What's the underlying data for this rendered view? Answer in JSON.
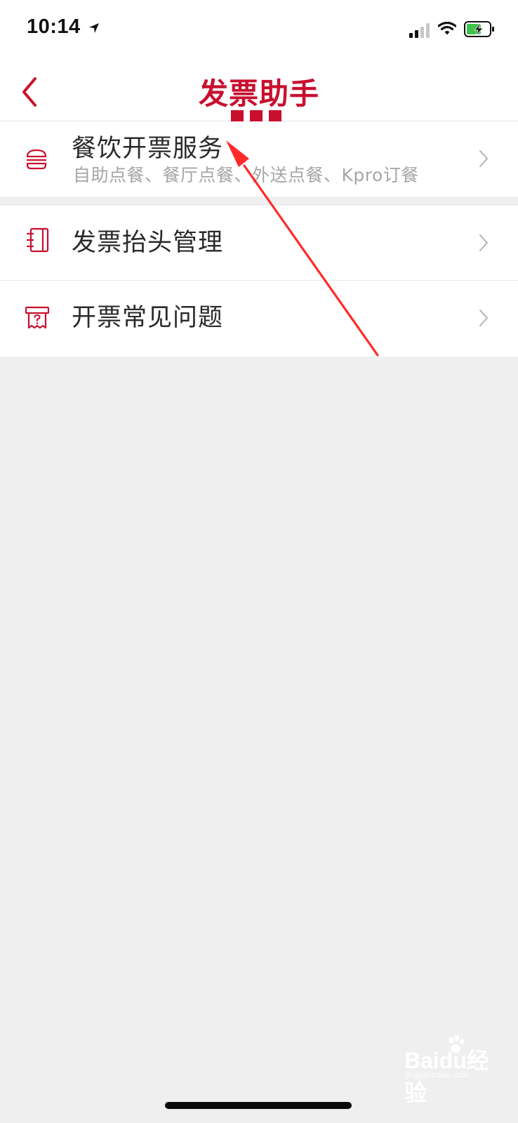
{
  "status_bar": {
    "time": "10:14"
  },
  "nav": {
    "title": "发票助手"
  },
  "menu": [
    {
      "title": "餐饮开票服务",
      "subtitle": "自助点餐、餐厅点餐、外送点餐、Kpro订餐",
      "icon": "burger-icon"
    },
    {
      "title": "发票抬头管理",
      "icon": "notebook-icon"
    },
    {
      "title": "开票常见问题",
      "icon": "question-receipt-icon"
    }
  ],
  "watermark": {
    "brand": "Baidu经验",
    "url": "jingyan.baidu.com"
  },
  "colors": {
    "accent": "#c8102e",
    "annotation_arrow": "#ff2a2a",
    "background": "#efefef"
  }
}
